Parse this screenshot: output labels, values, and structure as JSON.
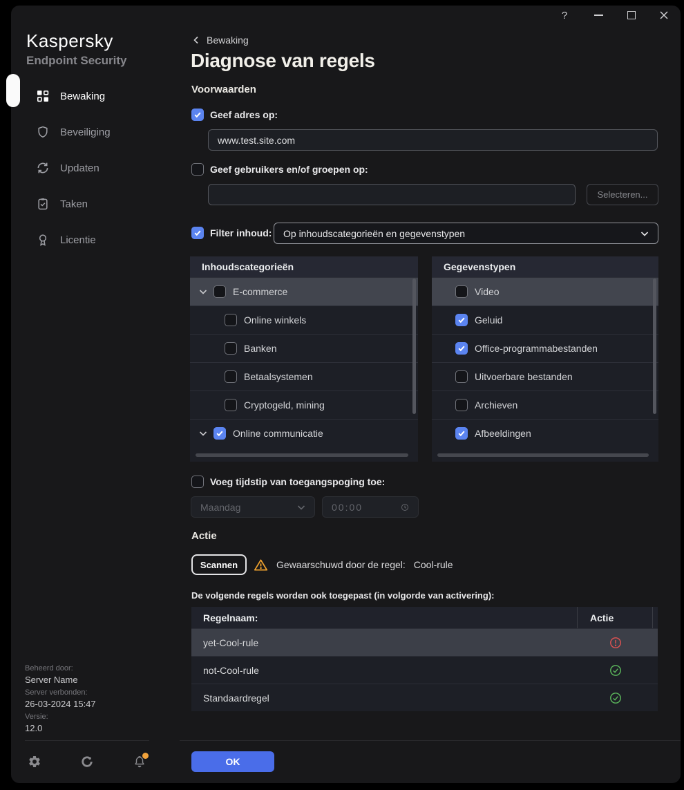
{
  "titlebar": {
    "help": "?"
  },
  "sidebar": {
    "brand": {
      "name": "Kaspersky",
      "product": "Endpoint Security"
    },
    "items": [
      {
        "label": "Bewaking",
        "active": true
      },
      {
        "label": "Beveiliging",
        "active": false
      },
      {
        "label": "Updaten",
        "active": false
      },
      {
        "label": "Taken",
        "active": false
      },
      {
        "label": "Licentie",
        "active": false
      }
    ],
    "management": {
      "managed_by_label": "Beheerd door:",
      "managed_by": "Server Name",
      "connected_label": "Server verbonden:",
      "connected": "26-03-2024 15:47",
      "version_label": "Versie:",
      "version": "12.0"
    }
  },
  "header": {
    "breadcrumb": "Bewaking",
    "title": "Diagnose van regels"
  },
  "conditions": {
    "section_title": "Voorwaarden",
    "address": {
      "label": "Geef adres op:",
      "checked": true,
      "value": "www.test.site.com"
    },
    "users": {
      "label": "Geef gebruikers en/of groepen op:",
      "checked": false,
      "value": "",
      "select_button": "Selecteren..."
    },
    "filter": {
      "label": "Filter inhoud:",
      "checked": true,
      "selected_option": "Op inhoudscategorieën en gegevenstypen"
    }
  },
  "categories_panel": {
    "title": "Inhoudscategorieën",
    "items": [
      {
        "label": "E-commerce",
        "checked": false,
        "expandable": true,
        "highlighted": true
      },
      {
        "label": "Online winkels",
        "checked": false
      },
      {
        "label": "Banken",
        "checked": false
      },
      {
        "label": "Betaalsystemen",
        "checked": false
      },
      {
        "label": "Cryptogeld, mining",
        "checked": false
      },
      {
        "label": "Online communicatie",
        "checked": true,
        "expandable": true
      }
    ]
  },
  "datatypes_panel": {
    "title": "Gegevenstypen",
    "items": [
      {
        "label": "Video",
        "checked": false,
        "highlighted": true
      },
      {
        "label": "Geluid",
        "checked": true
      },
      {
        "label": "Office-programmabestanden",
        "checked": true
      },
      {
        "label": "Uitvoerbare bestanden",
        "checked": false
      },
      {
        "label": "Archieven",
        "checked": false
      },
      {
        "label": "Afbeeldingen",
        "checked": true
      }
    ]
  },
  "time": {
    "label": "Voeg tijdstip van toegangspoging toe:",
    "checked": false,
    "day": "Maandag",
    "time": "00:00"
  },
  "action": {
    "section_title": "Actie",
    "scan_button": "Scannen",
    "warning_label": "Gewaarschuwd door de regel:",
    "rule_name": "Cool-rule"
  },
  "rules": {
    "intro": "De volgende regels worden ook toegepast (in volgorde van activering):",
    "columns": {
      "name": "Regelnaam:",
      "action": "Actie"
    },
    "rows": [
      {
        "name": "yet-Cool-rule",
        "status": "error",
        "highlighted": true
      },
      {
        "name": "not-Cool-rule",
        "status": "ok",
        "highlighted": false
      },
      {
        "name": "Standaardregel",
        "status": "ok",
        "highlighted": false
      }
    ]
  },
  "footer": {
    "ok_button": "OK"
  },
  "colors": {
    "accent_blue": "#5b84f0",
    "ok_blue": "#4a6de9",
    "warning": "#f0a22e",
    "error": "#e05252",
    "success": "#5cb85c",
    "notification_dot": "#f2a33c"
  }
}
